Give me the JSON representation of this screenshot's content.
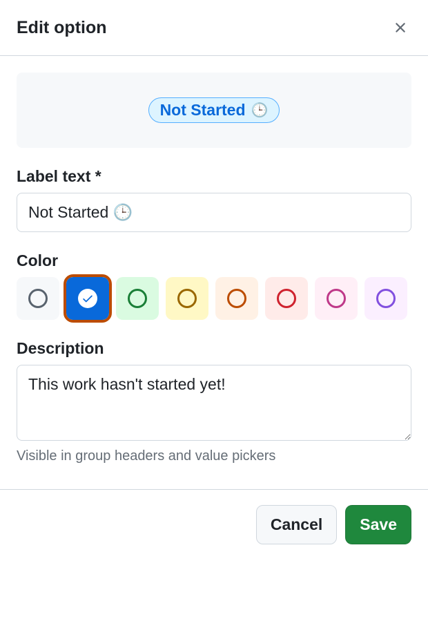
{
  "header": {
    "title": "Edit option"
  },
  "preview": {
    "label": "Not Started",
    "emoji": "🕒"
  },
  "fields": {
    "label_text": {
      "label": "Label text *",
      "value": "Not Started 🕒"
    },
    "color": {
      "label": "Color",
      "selected": "blue"
    },
    "description": {
      "label": "Description",
      "value": "This work hasn't started yet!",
      "helper": "Visible in group headers and value pickers"
    }
  },
  "footer": {
    "cancel": "Cancel",
    "save": "Save"
  }
}
